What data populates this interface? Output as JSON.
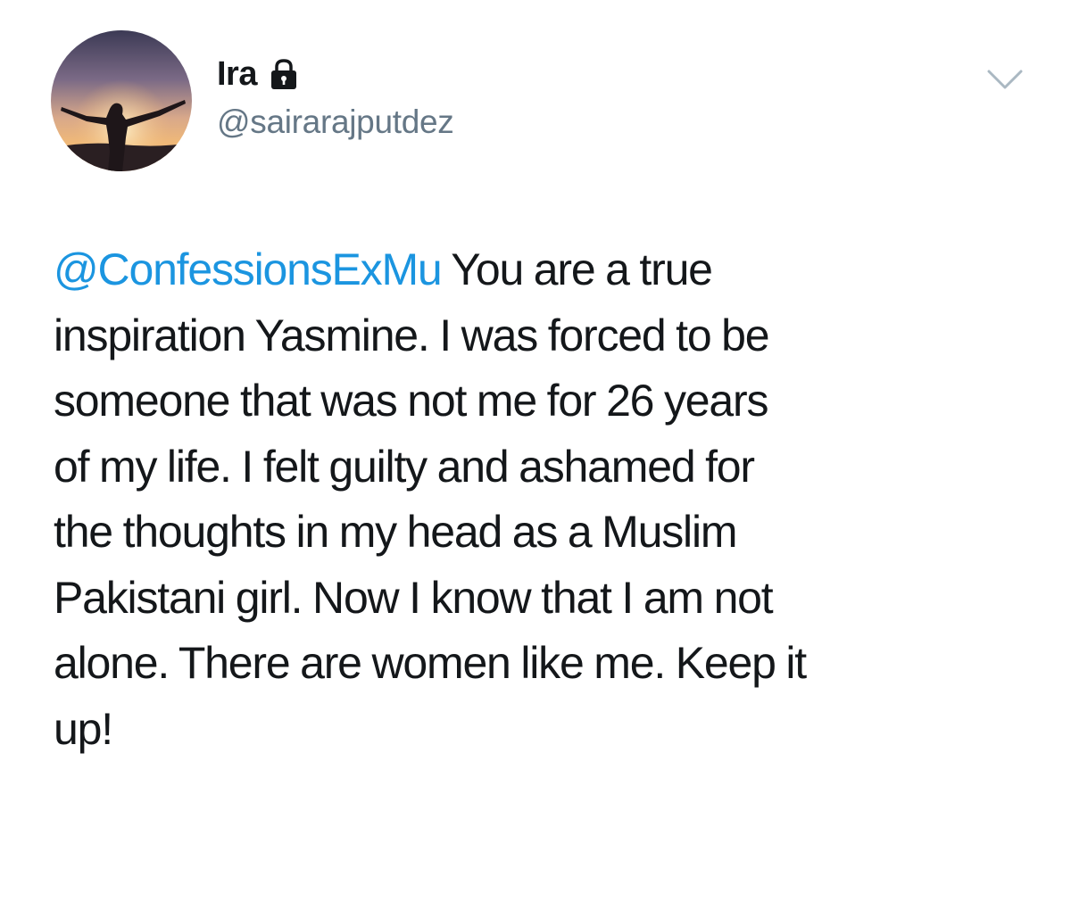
{
  "tweet": {
    "author": {
      "display_name": "Ira",
      "handle": "@sairarajputdez",
      "protected_icon": "lock-icon",
      "avatar_icon": "silhouette-sunset-avatar"
    },
    "menu_icon": "chevron-down-icon",
    "mention": "@ConfessionsExMu",
    "text_lines": [
      " You are a true",
      "inspiration Yasmine. I was forced to be",
      "someone that was not me for 26 years",
      "of my life. I felt guilty and ashamed for",
      "the thoughts in my head as a Muslim",
      "Pakistani girl. Now I know that I am not",
      "alone. There are women like me. Keep it",
      "up!"
    ]
  },
  "colors": {
    "text": "#14171a",
    "secondary": "#657786",
    "link": "#1b95e0",
    "background": "#ffffff"
  }
}
